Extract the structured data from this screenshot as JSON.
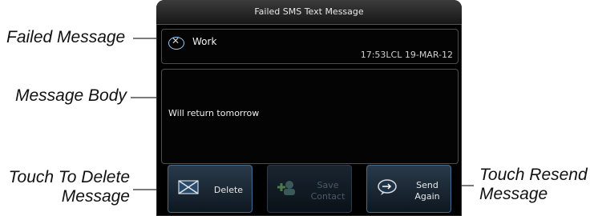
{
  "window": {
    "title": "Failed SMS Text Message"
  },
  "callouts": {
    "failed_message": "Failed Message",
    "message_body": "Message Body",
    "touch_delete": "Touch To Delete\nMessage",
    "touch_resend": "Touch Resend\nMessage"
  },
  "message": {
    "sender": "Work",
    "timestamp": "17:53LCL 19-MAR-12",
    "body": "Will return tomorrow"
  },
  "buttons": {
    "delete": "Delete",
    "save_contact": "Save\nContact",
    "send_again": "Send\nAgain"
  },
  "icons": {
    "status": "failed-x-icon",
    "delete": "delete-envelope-icon",
    "save": "add-contact-icon",
    "send": "send-bubble-icon"
  },
  "colors": {
    "screen_bg": "#000000",
    "button_border": "#4a6a8a",
    "accent_icon": "#9ad0ff"
  }
}
